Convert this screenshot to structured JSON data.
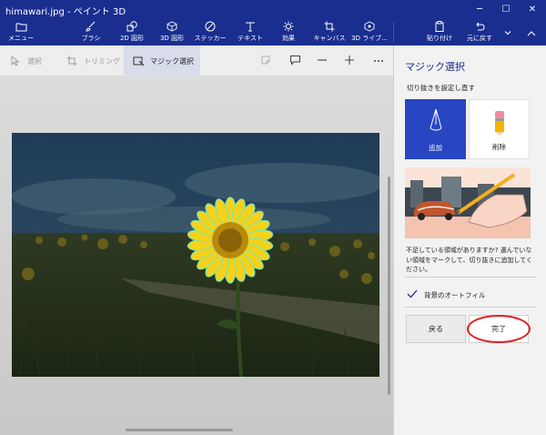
{
  "window": {
    "title": "himawari.jpg - ペイント 3D",
    "minimize_glyph": "─",
    "maximize_glyph": "☐",
    "close_glyph": "✕"
  },
  "ribbon": {
    "menu_label": "メニュー",
    "tools": [
      {
        "label": "ブラシ",
        "icon": "brush-icon"
      },
      {
        "label": "2D 図形",
        "icon": "shapes-2d-icon"
      },
      {
        "label": "3D 図形",
        "icon": "shapes-3d-icon"
      },
      {
        "label": "ステッカー",
        "icon": "sticker-icon"
      },
      {
        "label": "テキスト",
        "icon": "text-icon"
      },
      {
        "label": "効果",
        "icon": "effects-icon"
      },
      {
        "label": "キャンバス",
        "icon": "canvas-icon"
      },
      {
        "label": "3D ライブ...",
        "icon": "library-3d-icon"
      }
    ],
    "paste_label": "貼り付け",
    "undo_label": "元に戻す"
  },
  "subbar": {
    "select_label": "選択",
    "crop_label": "トリミング",
    "magic_select_label": "マジック選択"
  },
  "panel": {
    "title": "マジック選択",
    "subtitle": "切り抜きを設定し直す",
    "add_label": "追加",
    "remove_label": "削除",
    "help_text": "不足している領域がありますか? 選んでいない領域をマークして、切り抜きに追加してください。",
    "autofill_label": "背景のオートフィル",
    "autofill_checked": true,
    "back_label": "戻る",
    "done_label": "完了"
  },
  "colors": {
    "titlebar": "#1a2e8f",
    "accent": "#2845c2",
    "highlight_circle": "#e02020"
  }
}
